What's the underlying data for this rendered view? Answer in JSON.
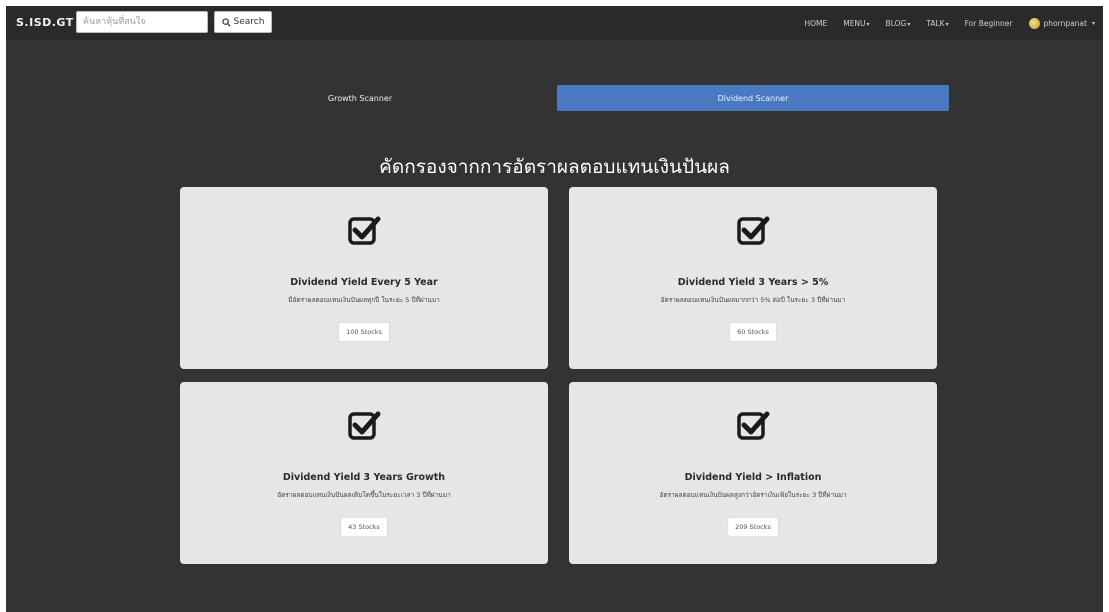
{
  "navbar": {
    "brand": "S.ISD.GT",
    "search_placeholder": "ค้นหาหุ้นที่สนใจ",
    "search_label": "Search",
    "items": [
      "HOME",
      "MENU",
      "BLOG",
      "TALK",
      "For Beginner"
    ],
    "user_name": "phornpanat"
  },
  "tabs": {
    "growth_label": "Growth Scanner",
    "dividend_label": "Dividend Scanner",
    "active_color": "#4a79c2"
  },
  "page_title": "คัดกรองจากการอัตราผลตอบแทนเงินปันผล",
  "cards": [
    {
      "title": "Dividend Yield Every 5 Year",
      "description": "มีอัตราผลตอบแทนเงินปันผลทุกปี ในระยะ 5 ปีที่ผ่านมา",
      "count": "100 Stocks",
      "icon": "checkbox-checked-icon"
    },
    {
      "title": "Dividend Yield 3 Years > 5%",
      "description": "อัตราผลตอบแทนเงินปันผลมากกว่า 5% ต่อปี ในระยะ 3 ปีที่ผ่านมา",
      "count": "60 Stocks",
      "icon": "checkbox-checked-icon"
    },
    {
      "title": "Dividend Yield 3 Years Growth",
      "description": "อัตราผลตอบแทนเงินปันผลเติบโตขึ้นในระยะเวลา 3 ปีที่ผ่านมา",
      "count": "43 Stocks",
      "icon": "checkbox-checked-icon"
    },
    {
      "title": "Dividend Yield > Inflation",
      "description": "อัตราผลตอบแทนเงินปันผลสูงกว่าอัตราเงินเฟ้อในระยะ 3 ปีที่ผ่านมา",
      "count": "209 Stocks",
      "icon": "checkbox-checked-icon"
    }
  ]
}
